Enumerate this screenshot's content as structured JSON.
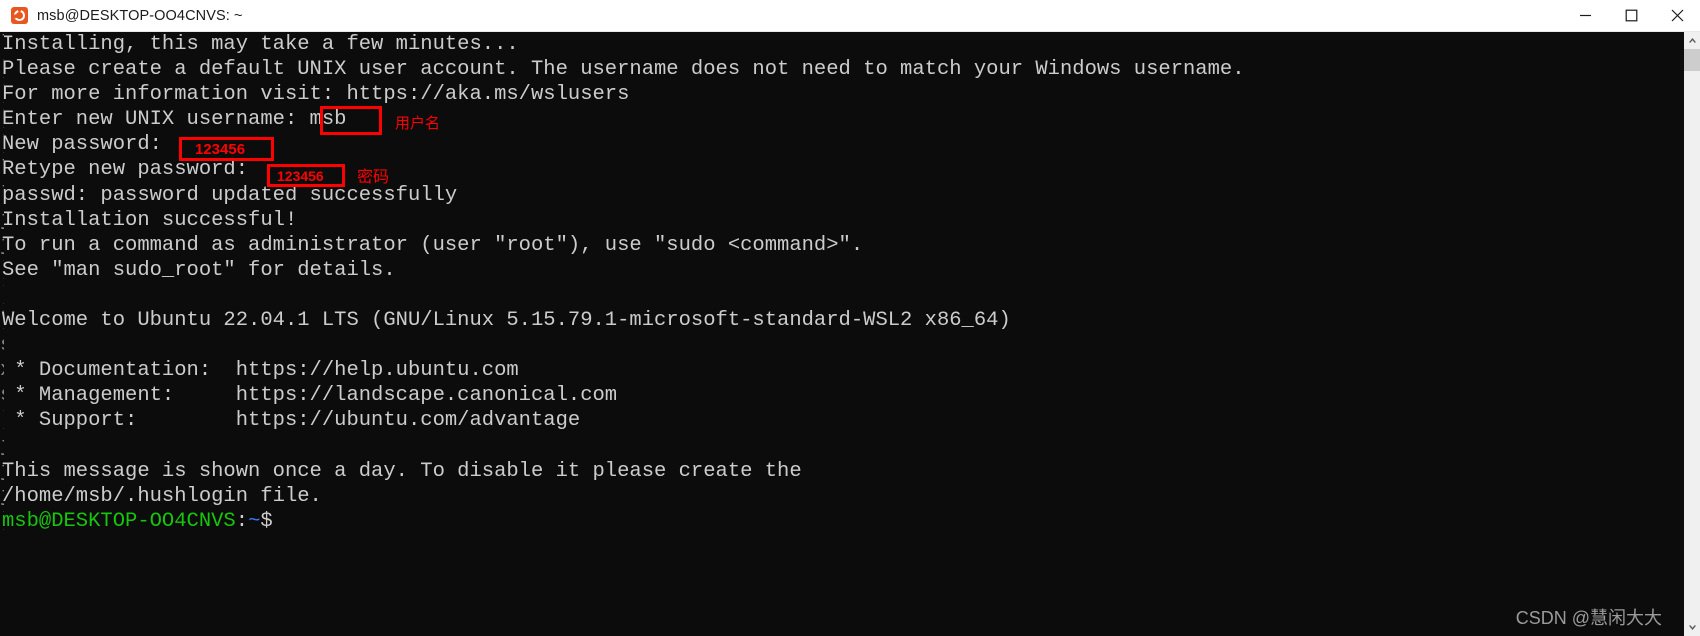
{
  "window": {
    "title": "msb@DESKTOP-OO4CNVS: ~",
    "icon": "ubuntu-icon",
    "controls": {
      "minimize": "minimize-button",
      "maximize": "maximize-button",
      "close": "close-button"
    }
  },
  "terminal": {
    "background": "#0c0c0c",
    "foreground": "#cccccc",
    "prompt_user_color": "#16c60c",
    "prompt_path_color": "#3b78ff",
    "lines": [
      "Installing, this may take a few minutes...",
      "Please create a default UNIX user account. The username does not need to match your Windows username.",
      "For more information visit: https://aka.ms/wslusers",
      "Enter new UNIX username: msb",
      "New password: ",
      "Retype new password: ",
      "passwd: password updated successfully",
      "Installation successful!",
      "To run a command as administrator (user \"root\"), use \"sudo <command>\".",
      "See \"man sudo_root\" for details.",
      "",
      "Welcome to Ubuntu 22.04.1 LTS (GNU/Linux 5.15.79.1-microsoft-standard-WSL2 x86_64)",
      "",
      " * Documentation:  https://help.ubuntu.com",
      " * Management:     https://landscape.canonical.com",
      " * Support:        https://ubuntu.com/advantage",
      "",
      "This message is shown once a day. To disable it please create the",
      "/home/msb/.hushlogin file."
    ],
    "prompt": {
      "userhost": "msb@DESKTOP-OO4CNVS",
      "colon": ":",
      "path": "~",
      "symbol": "$"
    }
  },
  "annotations": {
    "color": "#fe0000",
    "username_label": "用户名",
    "password_label": "密码",
    "password_value_1": "123456",
    "password_value_2": "123456"
  },
  "scrollbar": {
    "up_arrow": "scroll-up-arrow-icon",
    "down_arrow": "scroll-down-arrow-icon",
    "thumb": "scrollbar-thumb"
  },
  "watermark": "CSDN @慧闲大大"
}
